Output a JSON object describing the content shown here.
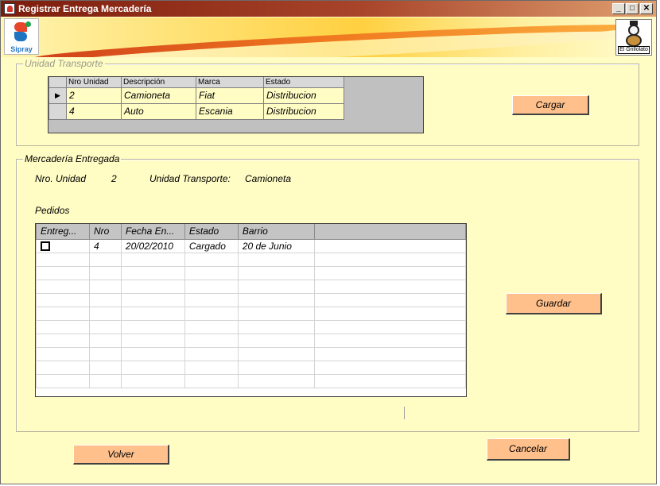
{
  "window": {
    "title": "Registrar Entrega Mercadería",
    "controls": {
      "minimize": "_",
      "maximize": "□",
      "close": "✕"
    }
  },
  "banner": {
    "left_logo_text": "Sipray",
    "right_logo_text": "El Grillolato"
  },
  "unidad_transporte": {
    "legend": "Unidad Transporte",
    "columns": [
      "Nro Unidad",
      "Descripción",
      "Marca",
      "Estado"
    ],
    "rows": [
      {
        "nro": "2",
        "descripcion": "Camioneta",
        "marca": "Fiat",
        "estado": "Distribucion",
        "selected": true
      },
      {
        "nro": "4",
        "descripcion": "Auto",
        "marca": "Escania",
        "estado": "Distribucion",
        "selected": false
      }
    ],
    "cargar_button": "Cargar"
  },
  "mercaderia": {
    "legend": "Mercadería Entregada",
    "nro_unidad_label": "Nro. Unidad",
    "nro_unidad_value": "2",
    "unidad_transporte_label": "Unidad Transporte:",
    "unidad_transporte_value": "Camioneta",
    "pedidos_label": "Pedidos",
    "columns": [
      "Entreg...",
      "Nro",
      "Fecha En...",
      "Estado",
      "Barrio"
    ],
    "rows": [
      {
        "entregado": false,
        "nro": "4",
        "fecha": "20/02/2010",
        "estado": "Cargado",
        "barrio": "20 de Junio"
      }
    ],
    "guardar_button": "Guardar"
  },
  "footer": {
    "volver_button": "Volver",
    "cancelar_button": "Cancelar"
  },
  "icons": {
    "row_indicator": "triangle-right-icon",
    "checkbox": "checkbox-unchecked-icon"
  }
}
